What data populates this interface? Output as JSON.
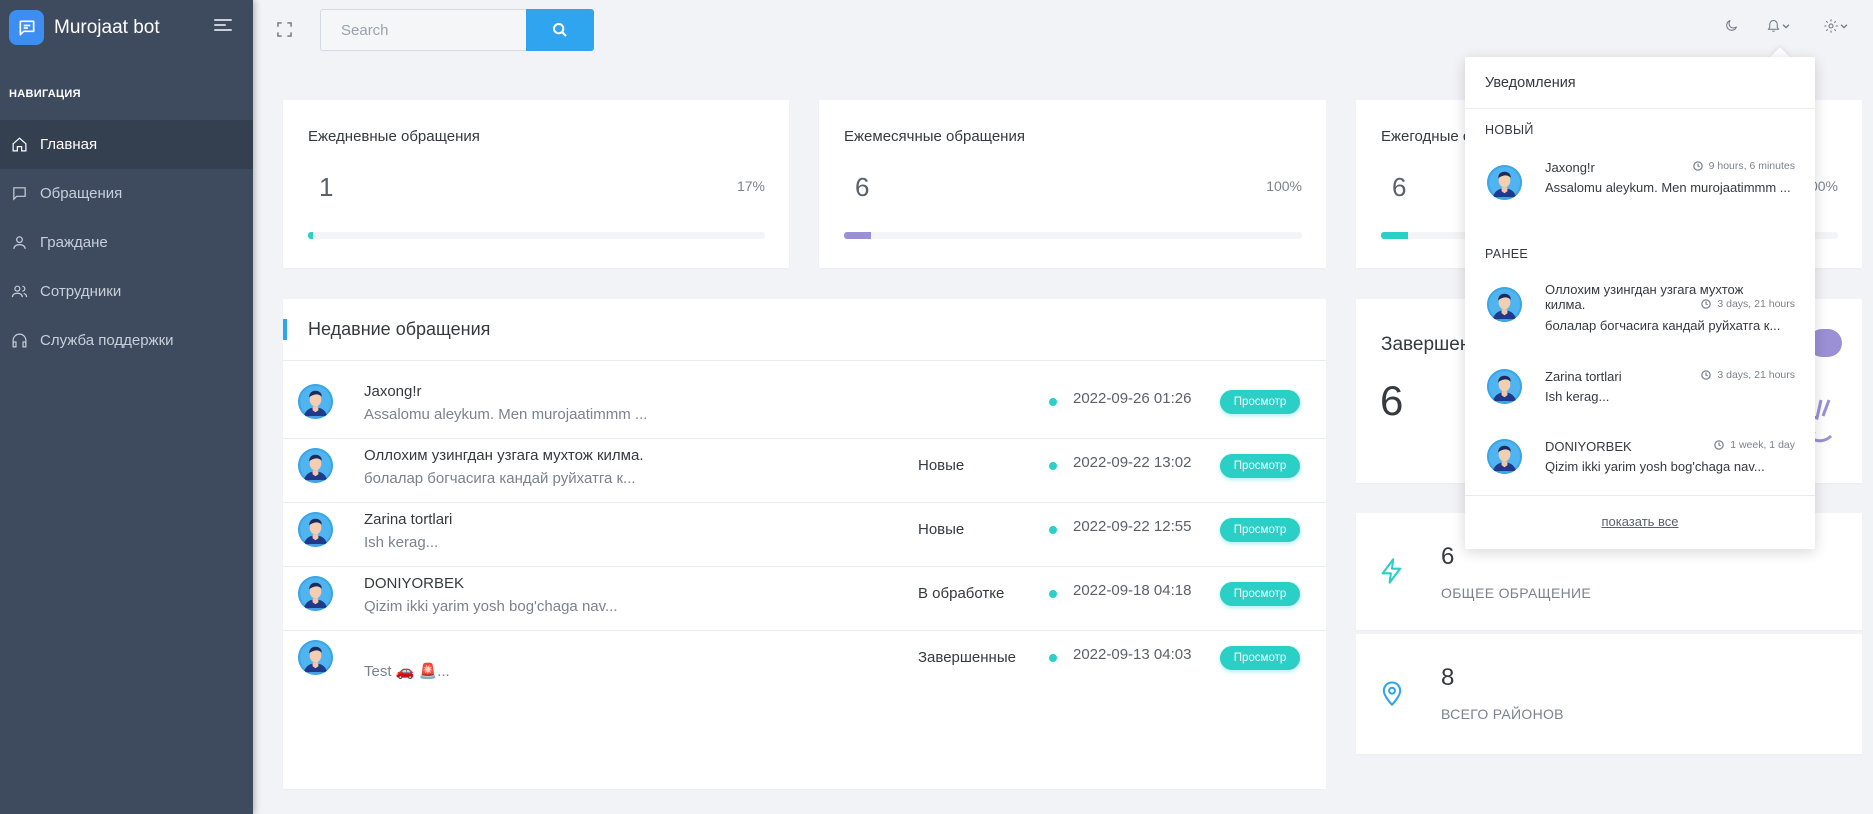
{
  "app": {
    "name": "Murojaat bot"
  },
  "sidebar": {
    "section_title": "НАВИГАЦИЯ",
    "items": [
      {
        "label": "Главная",
        "icon": "home-icon",
        "active": true
      },
      {
        "label": "Обращения",
        "icon": "chat-icon",
        "active": false
      },
      {
        "label": "Граждане",
        "icon": "user-icon",
        "active": false
      },
      {
        "label": "Сотрудники",
        "icon": "users-icon",
        "active": false
      },
      {
        "label": "Служба поддержки",
        "icon": "headphones-icon",
        "active": false
      }
    ]
  },
  "topbar": {
    "search_placeholder": "Search"
  },
  "stats": {
    "daily": {
      "title": "Ежедневные обращения",
      "value": "1",
      "percent": "17%",
      "progress": 0.01,
      "color": "#2ad0c5"
    },
    "monthly": {
      "title": "Ежемесячные обращения",
      "value": "6",
      "percent": "100%",
      "progress": 0.06,
      "color": "#9b8fd6"
    },
    "yearly": {
      "title": "Ежегодные с",
      "value": "6",
      "percent": "00%",
      "progress": 0.06,
      "color": "#2ad0c5"
    }
  },
  "recent": {
    "title": "Недавние обращения",
    "view_label": "Просмотр",
    "rows": [
      {
        "name": "Jaxong!r",
        "message": "Assalomu aleykum. Men murojaatimmm ...",
        "status": "",
        "date": "2022-09-26 01:26"
      },
      {
        "name": "Оллохим узингдан узгага мухтож килма.",
        "message": "болалар богчасига кандай руйхатга к...",
        "status": "Новые",
        "date": "2022-09-22 13:02"
      },
      {
        "name": "Zarina tortlari",
        "message": "Ish kerag...",
        "status": "Новые",
        "date": "2022-09-22 12:55"
      },
      {
        "name": "DONIYORBEK",
        "message": "Qizim ikki yarim yosh bog'chaga nav...",
        "status": "В обработке",
        "date": "2022-09-18 04:18"
      },
      {
        "name": "",
        "message": "Test 🚗 🚨...",
        "status": "Завершенные",
        "date": "2022-09-13 04:03"
      }
    ]
  },
  "completed": {
    "title": "Завершен",
    "value": "6"
  },
  "total": {
    "value": "6",
    "label": "ОБЩЕЕ ОБРАЩЕНИЕ"
  },
  "districts": {
    "value": "8",
    "label": "ВСЕГО РАЙОНОВ"
  },
  "notifications": {
    "title": "Уведомления",
    "new_label": "НОВЫЙ",
    "earlier_label": "РАНЕЕ",
    "show_all": "показать все",
    "new_items": [
      {
        "name": "Jaxong!r",
        "time": "9 hours, 6 minutes",
        "message": "Assalomu aleykum. Men murojaatimmm ..."
      }
    ],
    "earlier_items": [
      {
        "name": "Оллохим узингдан узгага мухтож килма.",
        "time": "3 days, 21 hours",
        "message": "болалар богчасига кандай руйхатга к..."
      },
      {
        "name": "Zarina tortlari",
        "time": "3 days, 21 hours",
        "message": "Ish kerag..."
      },
      {
        "name": "DONIYORBEK",
        "time": "1 week, 1 day",
        "message": "Qizim ikki yarim yosh bog'chaga nav..."
      }
    ]
  }
}
